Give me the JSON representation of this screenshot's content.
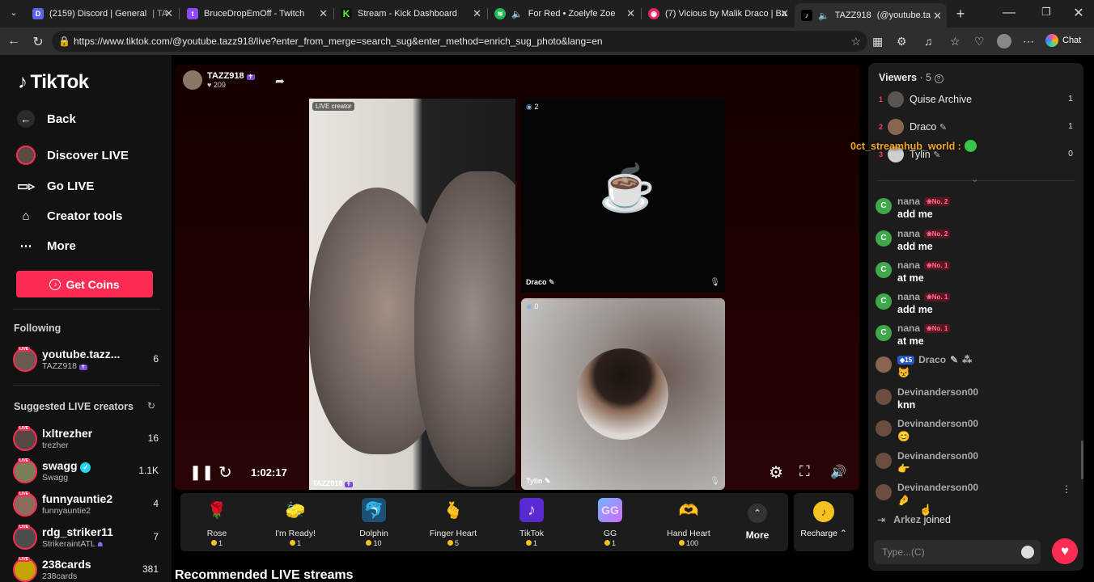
{
  "browser": {
    "tabs": [
      {
        "title": "(2159) Discord | General",
        "extra": "| TA",
        "icon_color": "#5865f2",
        "icon": "discord-icon"
      },
      {
        "title": "BruceDropEmOff - Twitch",
        "icon_color": "#9146ff",
        "icon": "twitch-icon"
      },
      {
        "title": "Stream - Kick Dashboard",
        "icon_color": "#53fc18",
        "icon": "kick-icon"
      },
      {
        "title": "For Red • Zoelyfe Zoe",
        "icon_color": "#1db954",
        "icon": "spotify-icon"
      },
      {
        "title": "(7) Vicious by Malik Draco | Ban",
        "icon_color": "#e0245e",
        "icon": "bandcamp-icon"
      },
      {
        "title": "TAZZ918",
        "extra": "(@youtube.ta",
        "icon_color": "#000000",
        "icon": "tiktok-icon"
      }
    ],
    "url": "https://www.tiktok.com/@youtube.tazz918/live?enter_from_merge=search_sug&enter_method=enrich_sug_photo&lang=en",
    "chat_label": "Chat"
  },
  "sidebar": {
    "logo": "TikTok",
    "nav": [
      {
        "label": "Back",
        "icon": "back-arrow-icon"
      },
      {
        "label": "Discover LIVE",
        "icon": "live-discover-icon"
      },
      {
        "label": "Go LIVE",
        "icon": "video-camera-icon"
      },
      {
        "label": "Creator tools",
        "icon": "creator-tools-icon"
      },
      {
        "label": "More",
        "icon": "ellipsis-icon"
      }
    ],
    "get_coins": "Get Coins",
    "following_title": "Following",
    "following": [
      {
        "name": "youtube.tazz...",
        "sub": "TAZZ918",
        "count": "6"
      }
    ],
    "suggested_title": "Suggested LIVE creators",
    "suggested": [
      {
        "name": "lxltrezher",
        "sub": "trezher",
        "count": "16"
      },
      {
        "name": "swagg",
        "sub": "Swagg",
        "count": "1.1K"
      },
      {
        "name": "funnyauntie2",
        "sub": "funnyauntie2",
        "count": "4"
      },
      {
        "name": "rdg_striker11",
        "sub": "StrikeraintATL",
        "count": "7"
      },
      {
        "name": "238cards",
        "sub": "238cards",
        "count": "381"
      }
    ]
  },
  "stream": {
    "host_name": "TAZZ918",
    "host_likes": "209",
    "pane1_label": "LIVE creator",
    "pane1_name": "TAZZ918",
    "pane2_count": "2",
    "pane2_name": "Draco",
    "pane3_count": "0",
    "pane3_name": "Tylin",
    "timer": "1:02:17"
  },
  "gifts": [
    {
      "name": "Rose",
      "price": "1",
      "emoji": "🌹",
      "bg": "#2a1a1a"
    },
    {
      "name": "I'm Ready!",
      "price": "1",
      "emoji": "🧽",
      "bg": "#2a2a12"
    },
    {
      "name": "Dolphin",
      "price": "10",
      "emoji": "🐬",
      "bg": "#143044"
    },
    {
      "name": "Finger Heart",
      "price": "5",
      "emoji": "🫰",
      "bg": "#2a1a1a"
    },
    {
      "name": "TikTok",
      "price": "1",
      "emoji": "♪",
      "bg": "#22143a"
    },
    {
      "name": "GG",
      "price": "1",
      "emoji": "GG",
      "bg": "#1f1f3a"
    },
    {
      "name": "Hand Heart",
      "price": "100",
      "emoji": "🫶",
      "bg": "#2a1a2a"
    }
  ],
  "gift_more": "More",
  "recharge": "Recharge",
  "recommended_title": "Recommended LIVE streams",
  "viewers": {
    "title": "Viewers",
    "count": "5",
    "list": [
      {
        "rank": "1",
        "name": "Quise Archive",
        "score": "1"
      },
      {
        "rank": "2",
        "name": "Draco",
        "score": "1"
      },
      {
        "rank": "3",
        "name": "Tylin",
        "score": "0"
      }
    ]
  },
  "overlay_tag": "0ct_streamhub_world :",
  "chat": [
    {
      "user": "nana",
      "badge": "No. 2",
      "text": "add me"
    },
    {
      "user": "nana",
      "badge": "No. 2",
      "text": "add me"
    },
    {
      "user": "nana",
      "badge": "No. 1",
      "text": "at me"
    },
    {
      "user": "nana",
      "badge": "No. 1",
      "text": "add me"
    },
    {
      "user": "nana",
      "badge": "No. 1",
      "text": "at me"
    },
    {
      "user": "Draco",
      "level": "15",
      "text": "😾"
    },
    {
      "user": "Devinanderson00",
      "text": "knn"
    },
    {
      "user": "Devinanderson00",
      "text": "😊"
    },
    {
      "user": "Devinanderson00",
      "text": "👉"
    },
    {
      "user": "Devinanderson00",
      "text": "🤌"
    }
  ],
  "join": {
    "user": "Arkez",
    "text": "joined"
  },
  "chat_placeholder": "Type...(C)"
}
